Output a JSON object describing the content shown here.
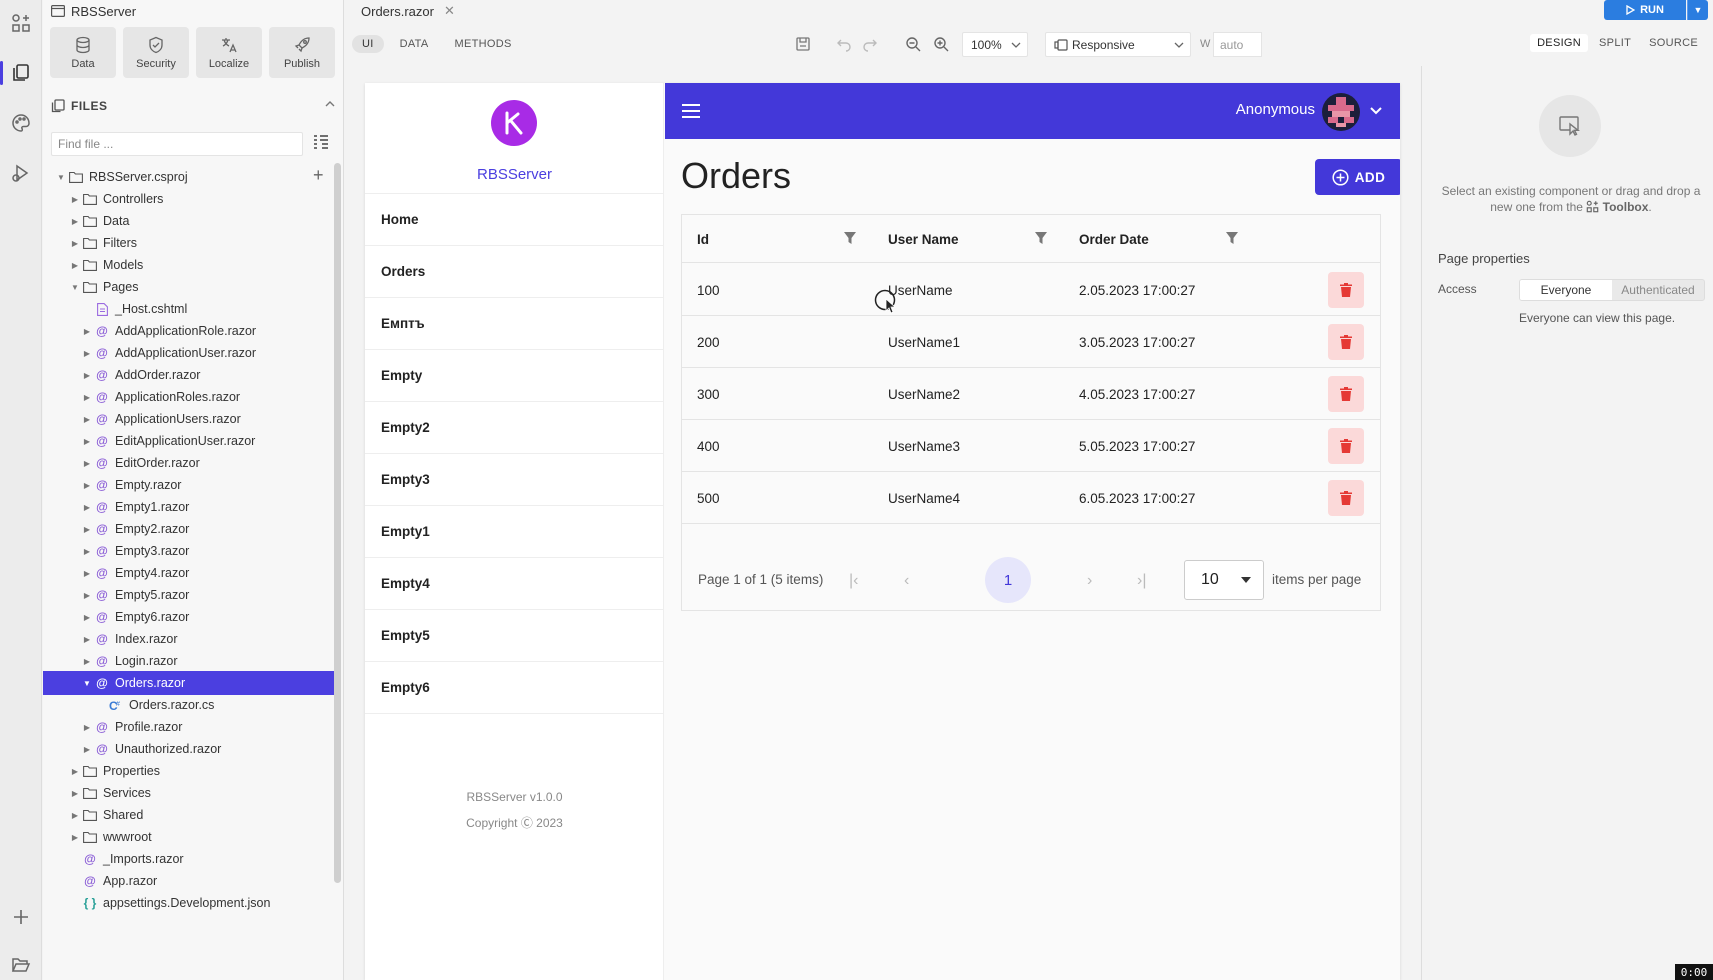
{
  "project": {
    "title": "RBSServer"
  },
  "quick_actions": [
    {
      "label": "Data",
      "icon": "database-icon"
    },
    {
      "label": "Security",
      "icon": "shield-icon"
    },
    {
      "label": "Localize",
      "icon": "translate-icon"
    },
    {
      "label": "Publish",
      "icon": "rocket-icon"
    }
  ],
  "files": {
    "heading": "FILES",
    "find_placeholder": "Find file ...",
    "tree": [
      {
        "label": "RBSServer.csproj",
        "kind": "folder",
        "caret": "▼",
        "depth": 0
      },
      {
        "label": "Controllers",
        "kind": "folder",
        "caret": "▶",
        "depth": 1
      },
      {
        "label": "Data",
        "kind": "folder",
        "caret": "▶",
        "depth": 1
      },
      {
        "label": "Filters",
        "kind": "folder",
        "caret": "▶",
        "depth": 1
      },
      {
        "label": "Models",
        "kind": "folder",
        "caret": "▶",
        "depth": 1
      },
      {
        "label": "Pages",
        "kind": "folder",
        "caret": "▼",
        "depth": 1
      },
      {
        "label": "_Host.cshtml",
        "kind": "file",
        "caret": "",
        "depth": 2
      },
      {
        "label": "AddApplicationRole.razor",
        "kind": "razor",
        "caret": "▶",
        "depth": 2
      },
      {
        "label": "AddApplicationUser.razor",
        "kind": "razor",
        "caret": "▶",
        "depth": 2
      },
      {
        "label": "AddOrder.razor",
        "kind": "razor",
        "caret": "▶",
        "depth": 2
      },
      {
        "label": "ApplicationRoles.razor",
        "kind": "razor",
        "caret": "▶",
        "depth": 2
      },
      {
        "label": "ApplicationUsers.razor",
        "kind": "razor",
        "caret": "▶",
        "depth": 2
      },
      {
        "label": "EditApplicationUser.razor",
        "kind": "razor",
        "caret": "▶",
        "depth": 2
      },
      {
        "label": "EditOrder.razor",
        "kind": "razor",
        "caret": "▶",
        "depth": 2
      },
      {
        "label": "Empty.razor",
        "kind": "razor",
        "caret": "▶",
        "depth": 2
      },
      {
        "label": "Empty1.razor",
        "kind": "razor",
        "caret": "▶",
        "depth": 2
      },
      {
        "label": "Empty2.razor",
        "kind": "razor",
        "caret": "▶",
        "depth": 2
      },
      {
        "label": "Empty3.razor",
        "kind": "razor",
        "caret": "▶",
        "depth": 2
      },
      {
        "label": "Empty4.razor",
        "kind": "razor",
        "caret": "▶",
        "depth": 2
      },
      {
        "label": "Empty5.razor",
        "kind": "razor",
        "caret": "▶",
        "depth": 2
      },
      {
        "label": "Empty6.razor",
        "kind": "razor",
        "caret": "▶",
        "depth": 2
      },
      {
        "label": "Index.razor",
        "kind": "razor",
        "caret": "▶",
        "depth": 2
      },
      {
        "label": "Login.razor",
        "kind": "razor",
        "caret": "▶",
        "depth": 2
      },
      {
        "label": "Orders.razor",
        "kind": "razor",
        "caret": "▼",
        "depth": 2,
        "selected": true
      },
      {
        "label": "Orders.razor.cs",
        "kind": "cs",
        "caret": "",
        "depth": 3
      },
      {
        "label": "Profile.razor",
        "kind": "razor",
        "caret": "▶",
        "depth": 2
      },
      {
        "label": "Unauthorized.razor",
        "kind": "razor",
        "caret": "▶",
        "depth": 2
      },
      {
        "label": "Properties",
        "kind": "folder",
        "caret": "▶",
        "depth": 1
      },
      {
        "label": "Services",
        "kind": "folder",
        "caret": "▶",
        "depth": 1
      },
      {
        "label": "Shared",
        "kind": "folder",
        "caret": "▶",
        "depth": 1
      },
      {
        "label": "wwwroot",
        "kind": "folder",
        "caret": "▶",
        "depth": 1
      },
      {
        "label": "_Imports.razor",
        "kind": "razor",
        "caret": "",
        "depth": 1
      },
      {
        "label": "App.razor",
        "kind": "razor",
        "caret": "",
        "depth": 1
      },
      {
        "label": "appsettings.Development.json",
        "kind": "json",
        "caret": "",
        "depth": 1
      }
    ]
  },
  "editor": {
    "tab_label": "Orders.razor",
    "run_label": "RUN",
    "mode_tabs": [
      {
        "label": "UI",
        "active": true
      },
      {
        "label": "DATA",
        "active": false
      },
      {
        "label": "METHODS",
        "active": false
      }
    ],
    "zoom": "100%",
    "device": "Responsive",
    "width_label": "W",
    "width_placeholder": "auto",
    "view_tabs": [
      {
        "label": "DESIGN",
        "active": true
      },
      {
        "label": "SPLIT",
        "active": false
      },
      {
        "label": "SOURCE",
        "active": false
      }
    ]
  },
  "app": {
    "brand": "RBSServer",
    "nav": [
      "Home",
      "Orders",
      "Емптъ",
      "Empty",
      "Empty2",
      "Empty3",
      "Empty1",
      "Empty4",
      "Empty5",
      "Empty6"
    ],
    "footer_version": "RBSServer v1.0.0",
    "footer_copyright": "Copyright Ⓒ 2023",
    "user": "Anonymous",
    "page_title": "Orders",
    "add_label": "ADD",
    "grid": {
      "columns": [
        "Id",
        "User Name",
        "Order Date"
      ],
      "rows": [
        {
          "id": "100",
          "user": "UserName",
          "date": "2.05.2023 17:00:27"
        },
        {
          "id": "200",
          "user": "UserName1",
          "date": "3.05.2023 17:00:27"
        },
        {
          "id": "300",
          "user": "UserName2",
          "date": "4.05.2023 17:00:27"
        },
        {
          "id": "400",
          "user": "UserName3",
          "date": "5.05.2023 17:00:27"
        },
        {
          "id": "500",
          "user": "UserName4",
          "date": "6.05.2023 17:00:27"
        }
      ],
      "summary": "Page 1 of 1 (5 items)",
      "current_page": "1",
      "page_size": "10",
      "items_per_page": "items per page"
    }
  },
  "properties": {
    "hint_prefix": "Select an existing component or drag and drop a new one from the",
    "hint_toolbox": "Toolbox",
    "hint_suffix": ".",
    "section_title": "Page properties",
    "access_label": "Access",
    "access_options": [
      {
        "label": "Everyone",
        "active": true
      },
      {
        "label": "Authenticated",
        "active": false
      }
    ],
    "access_note": "Everyone can view this page."
  },
  "recorder_time": "0:00",
  "colors": {
    "accent": "#4338d9",
    "brand_logo": "#a82be6",
    "danger": "#e53935",
    "selection": "#4b3fe0"
  }
}
